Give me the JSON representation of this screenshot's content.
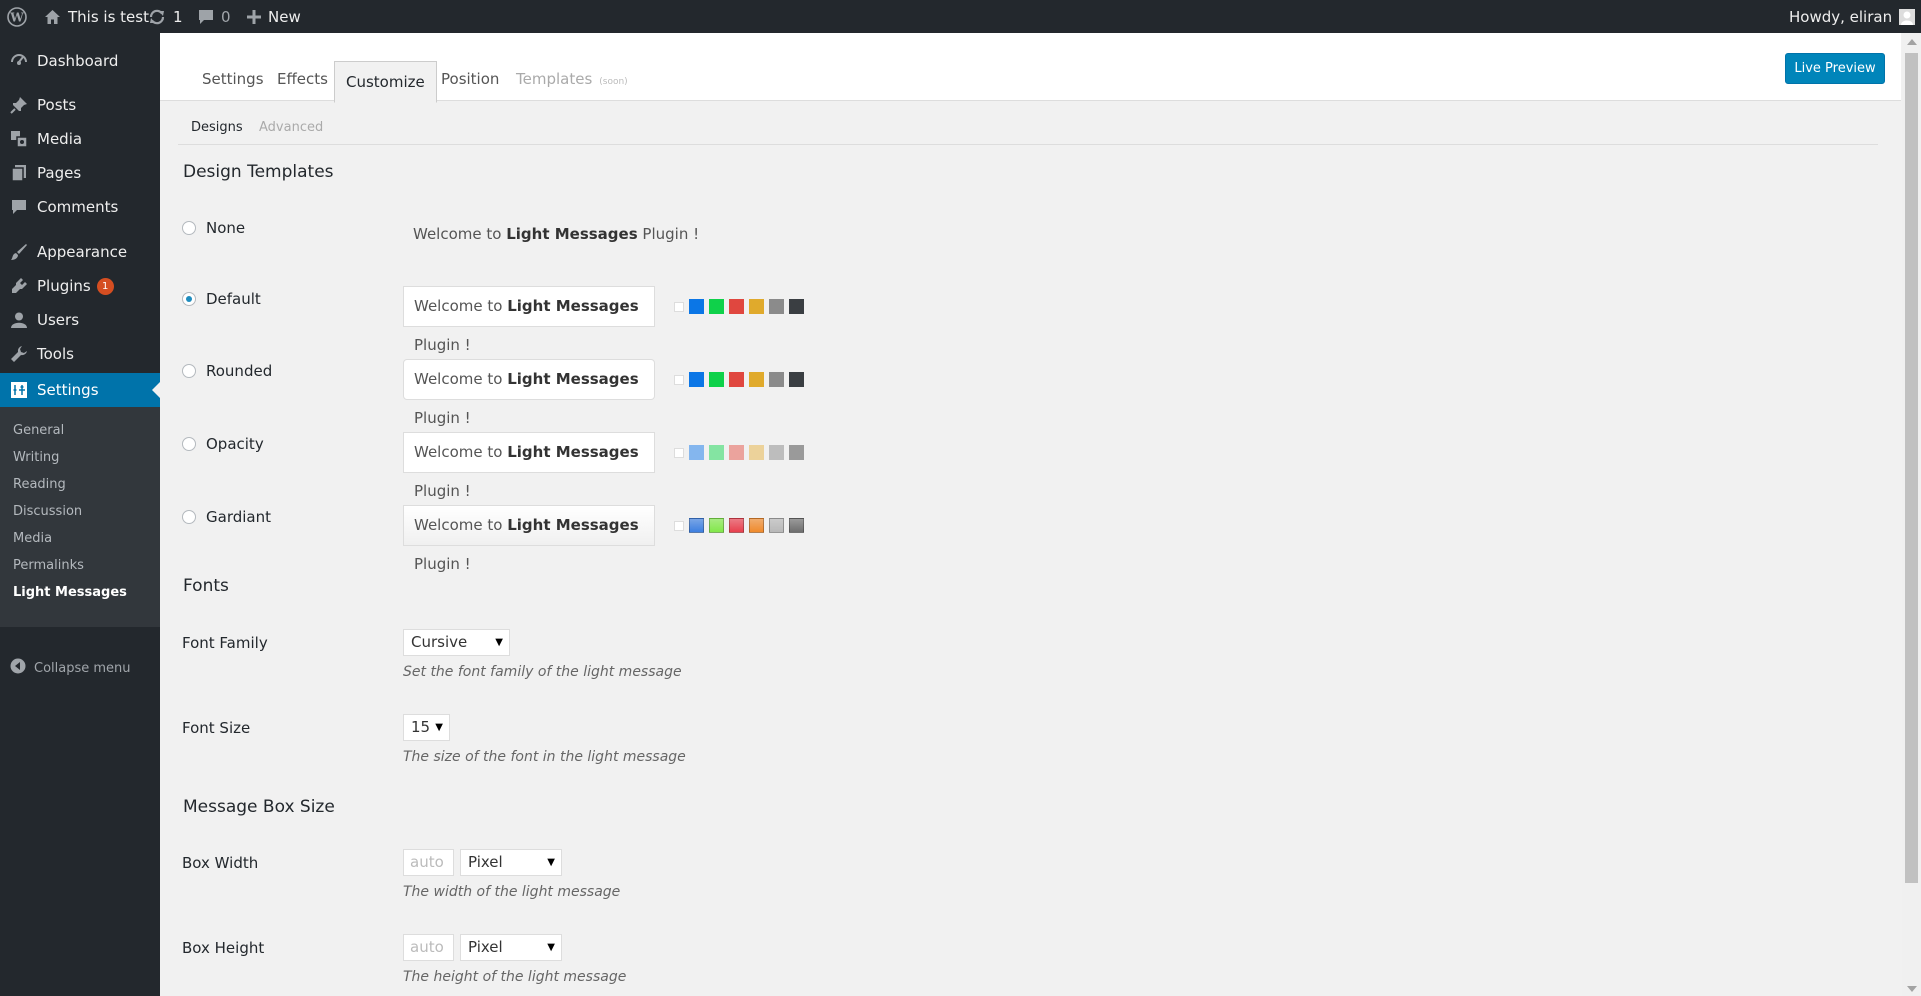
{
  "adminbar": {
    "site_name": "This is test",
    "updates_count": "1",
    "comments_count": "0",
    "new_label": "New",
    "howdy": "Howdy, eliran"
  },
  "menu": {
    "items": [
      {
        "label": "Dashboard",
        "icon": "dashboard-icon"
      },
      {
        "label": "Posts",
        "icon": "pin-icon"
      },
      {
        "label": "Media",
        "icon": "media-icon"
      },
      {
        "label": "Pages",
        "icon": "pages-icon"
      },
      {
        "label": "Comments",
        "icon": "comment-icon"
      },
      {
        "label": "Appearance",
        "icon": "brush-icon"
      },
      {
        "label": "Plugins",
        "icon": "plugin-icon",
        "badge": "1"
      },
      {
        "label": "Users",
        "icon": "user-icon"
      },
      {
        "label": "Tools",
        "icon": "wrench-icon"
      },
      {
        "label": "Settings",
        "icon": "settings-icon"
      }
    ],
    "submenu": [
      "General",
      "Writing",
      "Reading",
      "Discussion",
      "Media",
      "Permalinks",
      "Light Messages"
    ],
    "collapse_label": "Collapse menu"
  },
  "tabs": [
    {
      "label": "Settings"
    },
    {
      "label": "Effects"
    },
    {
      "label": "Customize"
    },
    {
      "label": "Position"
    },
    {
      "label": "Templates",
      "note": "(soon)"
    }
  ],
  "live_preview": "Live Preview",
  "subtabs": [
    "Designs",
    "Advanced"
  ],
  "design": {
    "heading": "Design Templates",
    "message_pre": "Welcome to ",
    "message_bold": "Light Messages",
    "message_post": " Plugin !",
    "options": [
      {
        "label": "None",
        "checked": false
      },
      {
        "label": "Default",
        "checked": true,
        "colors": [
          "#0b76e6",
          "#0fd14a",
          "#e0473f",
          "#e0aa2c",
          "#8b8b8b",
          "#3a3e42"
        ]
      },
      {
        "label": "Rounded",
        "checked": false,
        "colors": [
          "#0b76e6",
          "#0fd14a",
          "#e0473f",
          "#e0aa2c",
          "#8b8b8b",
          "#3a3e42"
        ]
      },
      {
        "label": "Opacity",
        "checked": false,
        "colors": [
          "#84b6ee",
          "#84e4a2",
          "#eba39d",
          "#ecd29a",
          "#bdbdbd",
          "#9a9a9a"
        ]
      },
      {
        "label": "Gardiant",
        "checked": false,
        "colors": [
          "#3d7fe0",
          "#82e84a",
          "#e8404e",
          "#f08a2c",
          "#b8b8b8",
          "#6e6e6e"
        ]
      }
    ]
  },
  "fonts": {
    "heading": "Fonts",
    "family_label": "Font Family",
    "family_value": "Cursive",
    "family_desc": "Set the font family of the light message",
    "size_label": "Font Size",
    "size_value": "15",
    "size_desc": "The size of the font in the light message"
  },
  "box": {
    "heading": "Message Box Size",
    "width_label": "Box Width",
    "width_placeholder": "auto",
    "width_unit": "Pixel",
    "width_desc": "The width of the light message",
    "height_label": "Box Height",
    "height_placeholder": "auto",
    "height_unit": "Pixel",
    "height_desc": "The height of the light message"
  }
}
